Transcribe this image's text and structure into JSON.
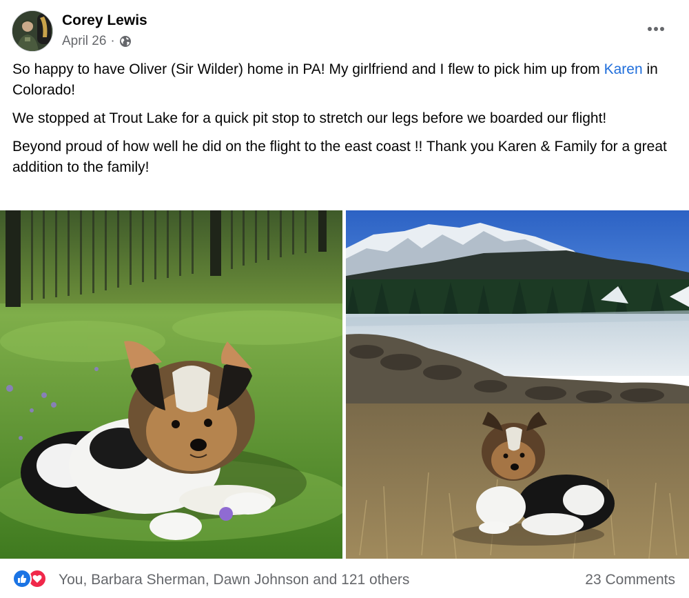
{
  "post": {
    "author": "Corey Lewis",
    "date": "April 26",
    "separator": "·",
    "privacy_icon": "globe-icon",
    "more_icon": "more-options-icon",
    "paragraphs": {
      "p1_before": "So happy to have Oliver (Sir Wilder) home in PA!  My girlfriend and I flew to pick him up from ",
      "p1_link": "Karen",
      "p1_after": " in Colorado!",
      "p2": "We stopped at Trout Lake for a quick pit stop to stretch our legs before we boarded our flight!",
      "p3": "Beyond proud of how well he did on the flight to the east coast !!  Thank you Karen & Family for a great addition to the family!"
    },
    "photos": [
      {
        "subject": "puppy-on-grass-photo"
      },
      {
        "subject": "puppy-at-trout-lake-photo"
      }
    ]
  },
  "footer": {
    "reaction_icons": [
      "like-icon",
      "love-icon"
    ],
    "reactors_text": "You, Barbara Sherman, Dawn Johnson and 121 others",
    "comments_text": "23 Comments"
  },
  "colors": {
    "link": "#216fdb",
    "secondary_text": "#65676b",
    "like_blue": "#1b74e4",
    "love_red": "#f0284a"
  }
}
